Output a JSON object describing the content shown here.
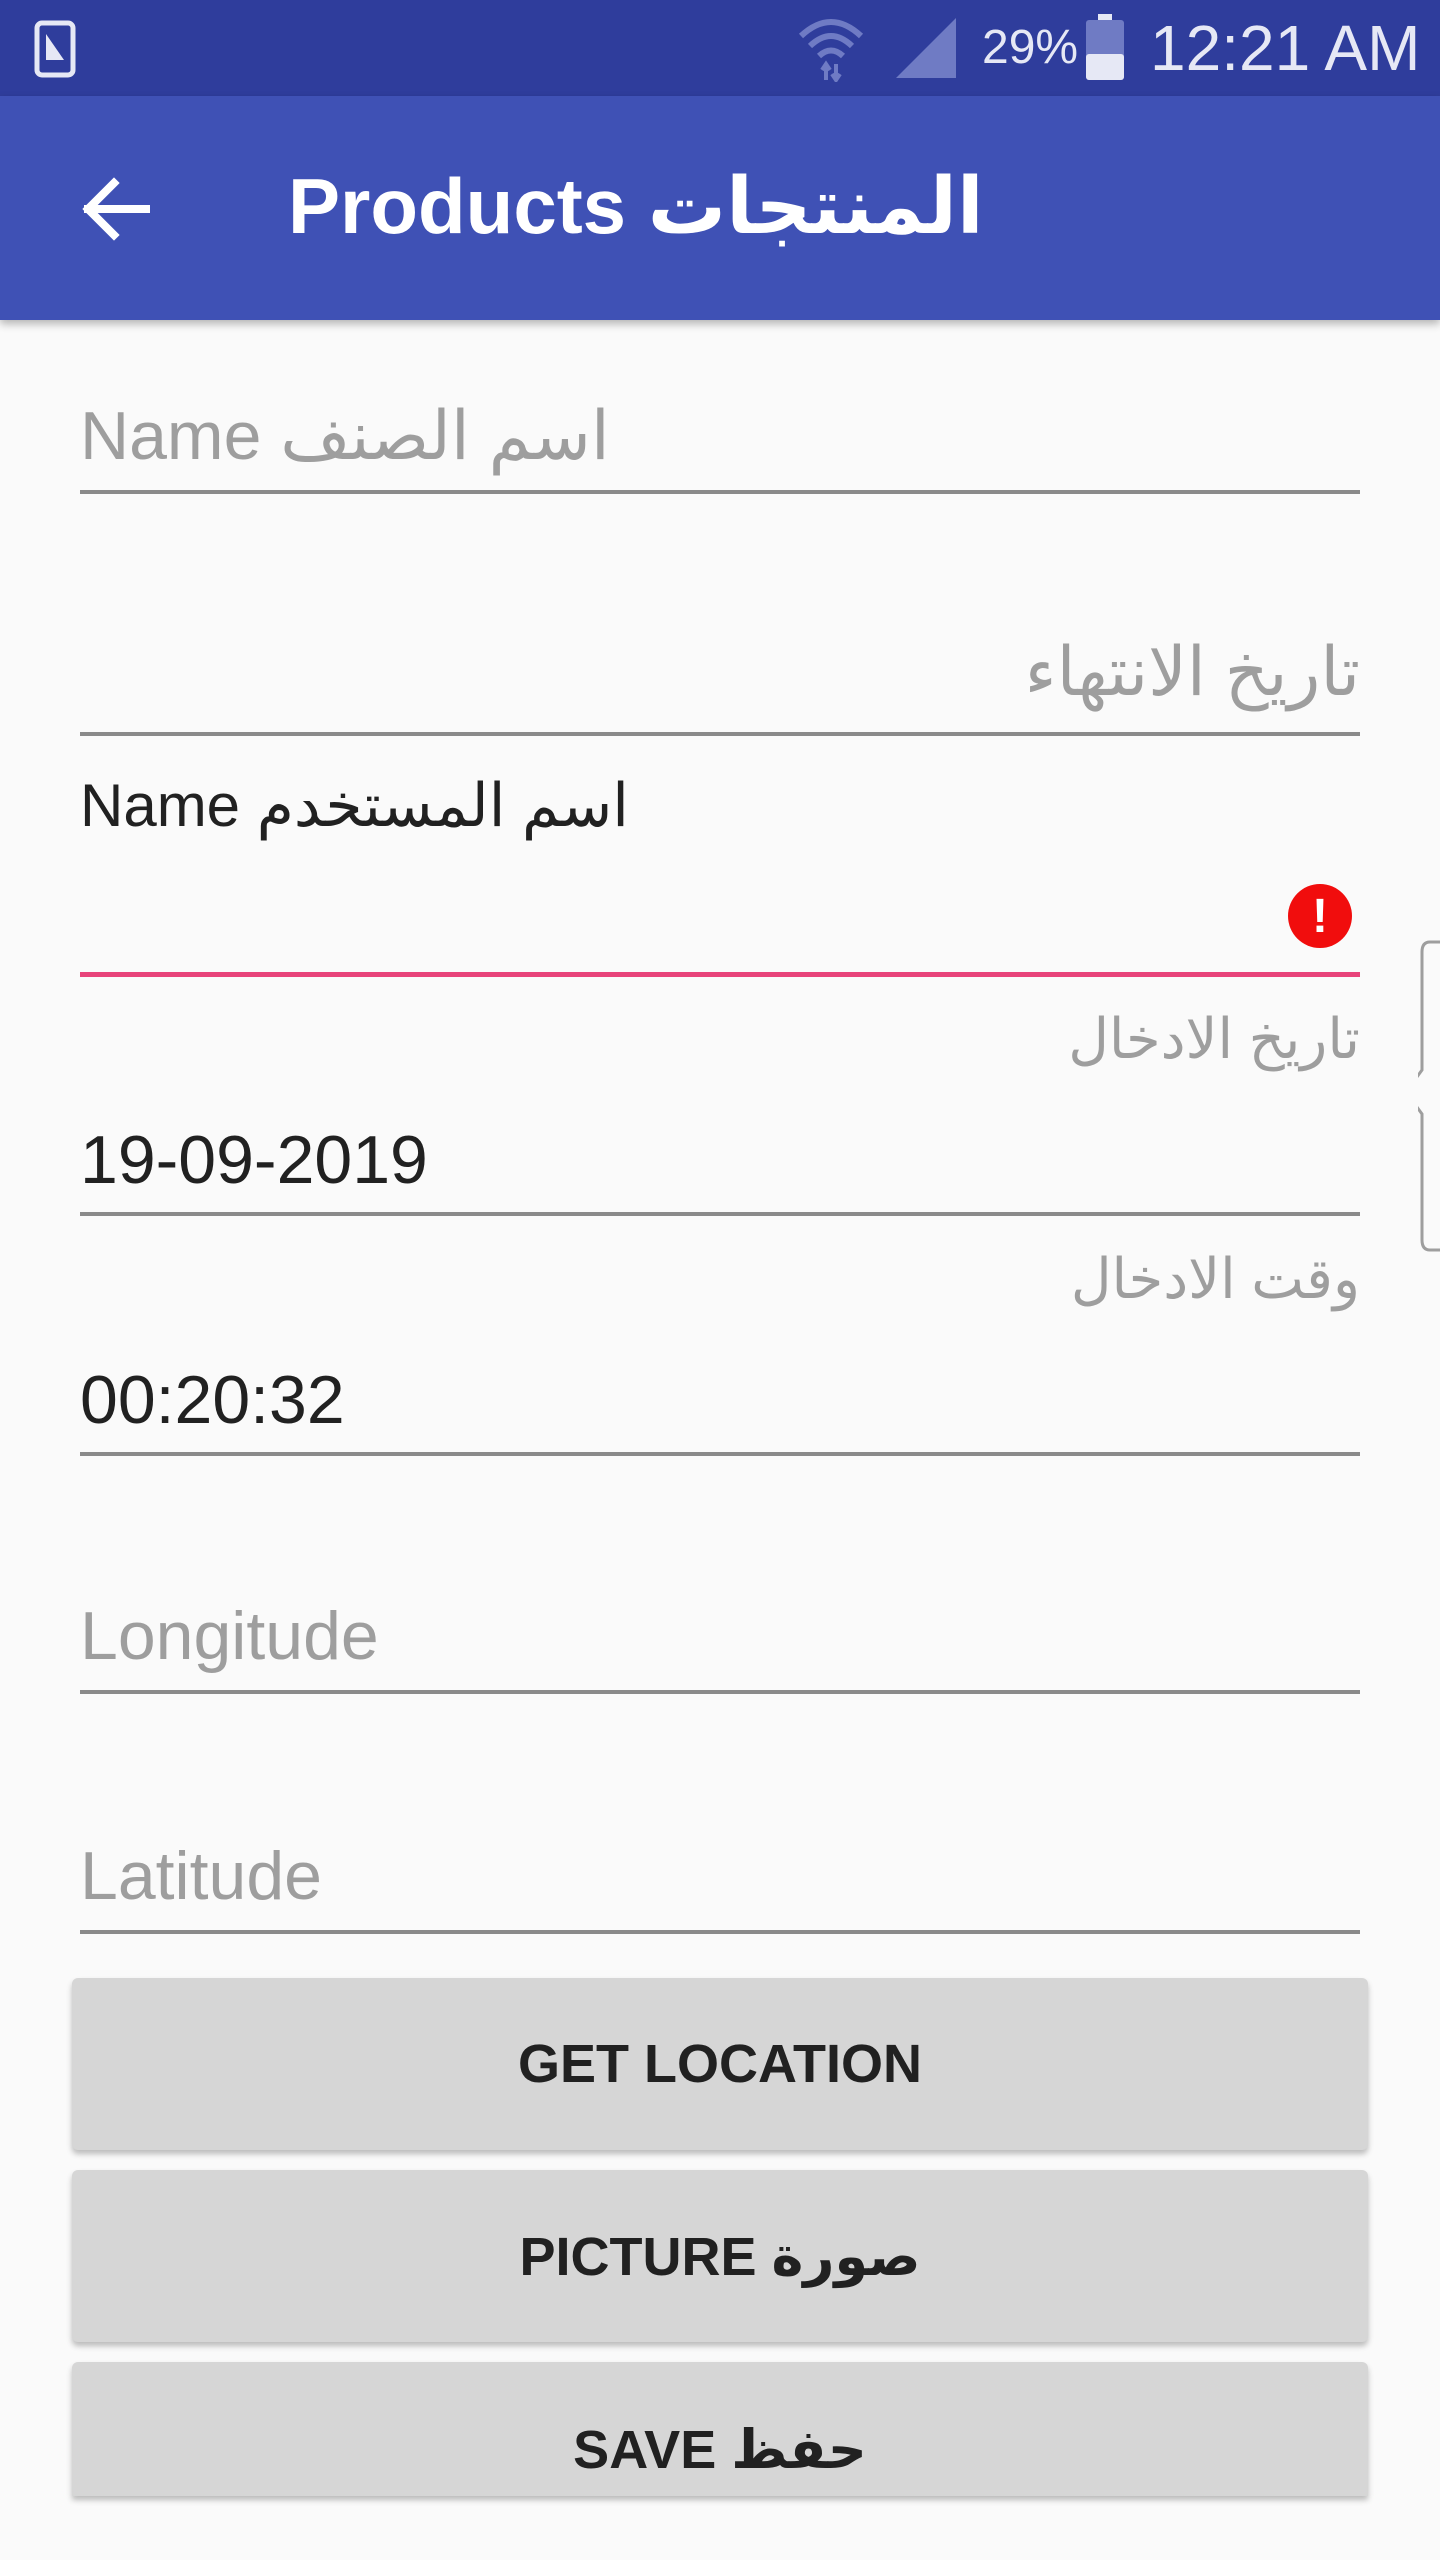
{
  "status_bar": {
    "battery_percent": "29%",
    "time": "12:21 AM",
    "icons": [
      "screenshot-icon",
      "wifi-icon",
      "signal-icon",
      "battery-icon"
    ]
  },
  "app_bar": {
    "title": "Products المنتجات",
    "back_icon": "arrow-left-icon",
    "color": "#3f51b5"
  },
  "form": {
    "item_name": {
      "hint": "Name اسم الصنف"
    },
    "expiry_date": {
      "hint": "تاريخ الانتهاء"
    },
    "user_name": {
      "label": "Name اسم المستخدم",
      "value": "",
      "error_color": "#e91e63"
    },
    "entry_date": {
      "label": "تاريخ الادخال",
      "value": "19-09-2019"
    },
    "entry_time": {
      "label": "وقت الادخال",
      "value": "00:20:32"
    },
    "longitude": {
      "hint": "Longitude"
    },
    "latitude": {
      "hint": "Latitude"
    }
  },
  "buttons": {
    "get_location": "GET LOCATION",
    "picture": "PICTURE صورة",
    "save": "SAVE حفظ"
  }
}
